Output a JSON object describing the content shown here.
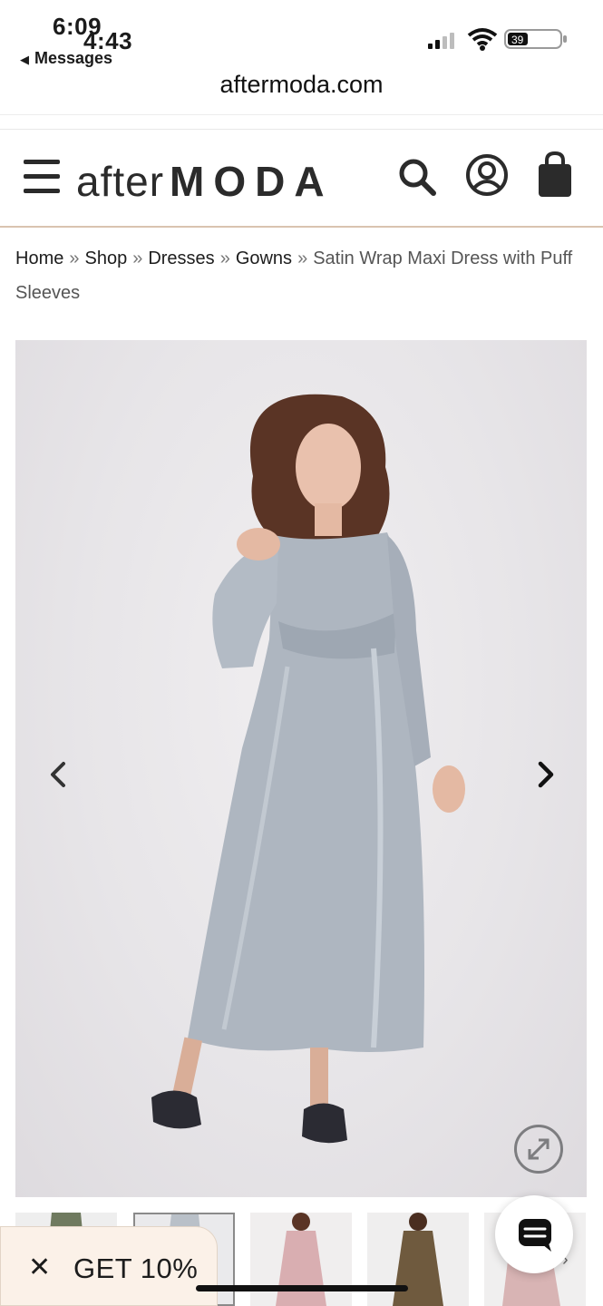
{
  "status_bar": {
    "time_primary": "6:09",
    "time_secondary": "4:43",
    "back_label": "Messages",
    "battery_level": "39"
  },
  "browser": {
    "url": "aftermoda.com"
  },
  "header": {
    "logo_part1": "after",
    "logo_part2": "MODA"
  },
  "breadcrumb": {
    "items": [
      "Home",
      "Shop",
      "Dresses",
      "Gowns"
    ],
    "separator": "»",
    "current": "Satin Wrap Maxi Dress with Puff Sleeves"
  },
  "gallery": {
    "prev_icon": "chevron-left-icon",
    "next_icon": "chevron-right-icon",
    "zoom_icon": "expand-icon",
    "thumbnail_colors": [
      "#6f7a5f",
      "#b9c0c8",
      "#d9aeb1",
      "#6f5a3e",
      "#d8b4b4"
    ],
    "active_thumbnail": 1
  },
  "promo": {
    "close_label": "✕",
    "text": "GET 10%"
  },
  "colors": {
    "accent_line": "#d9c3b0",
    "promo_bg": "#fbf1e8",
    "dress": "#aeb6c0"
  }
}
